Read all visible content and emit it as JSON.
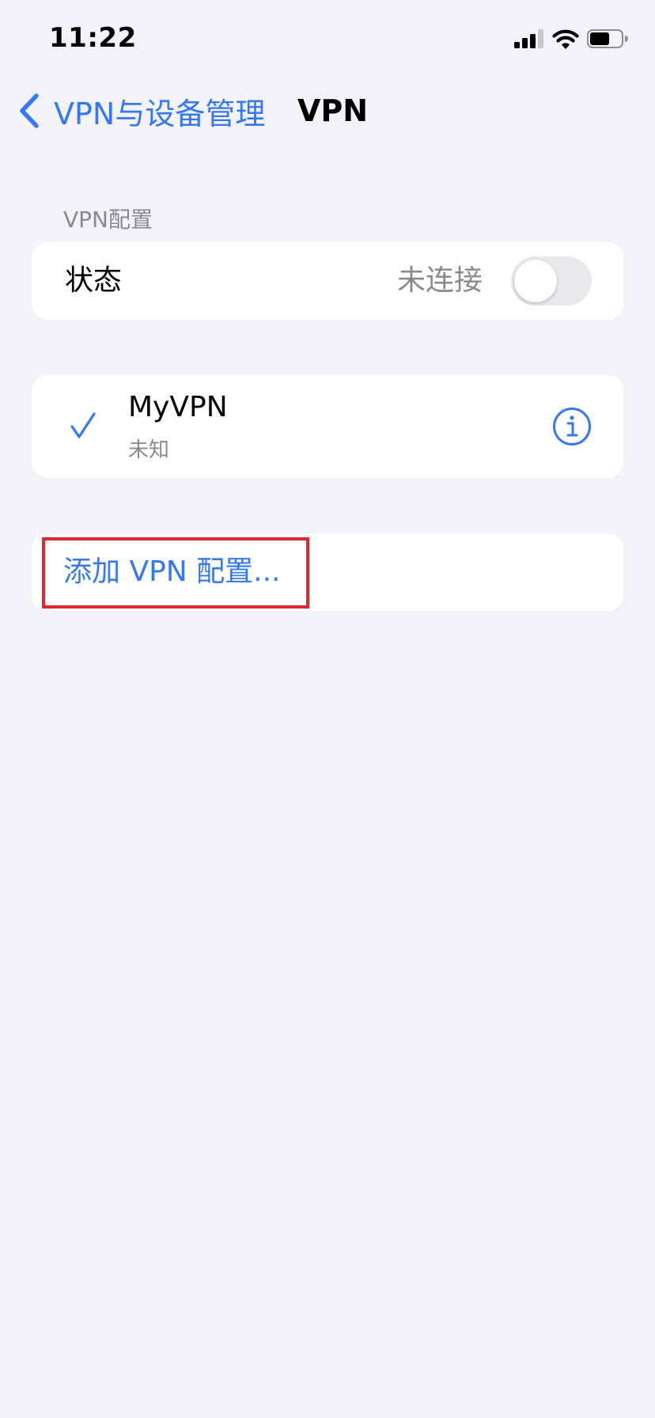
{
  "status_bar": {
    "time": "11:22"
  },
  "nav": {
    "back_label": "VPN与设备管理",
    "title": "VPN"
  },
  "vpn_config_section": {
    "header": "VPN配置",
    "status_label": "状态",
    "status_value": "未连接",
    "toggle_on": false
  },
  "vpn_list": [
    {
      "name": "MyVPN",
      "status": "未知",
      "selected": true
    }
  ],
  "add_config": {
    "label": "添加 VPN 配置..."
  },
  "icons": {
    "back": "chevron-left-icon",
    "check": "checkmark-icon",
    "info": "info-circle-icon",
    "signal": "cellular-signal-icon",
    "wifi": "wifi-icon",
    "battery": "battery-icon"
  },
  "colors": {
    "accent": "#3478f6",
    "background": "#f2f2f7",
    "secondary_text": "#8a8a8e",
    "toggle_off": "#e9e9eb",
    "highlight": "#e5242e"
  }
}
